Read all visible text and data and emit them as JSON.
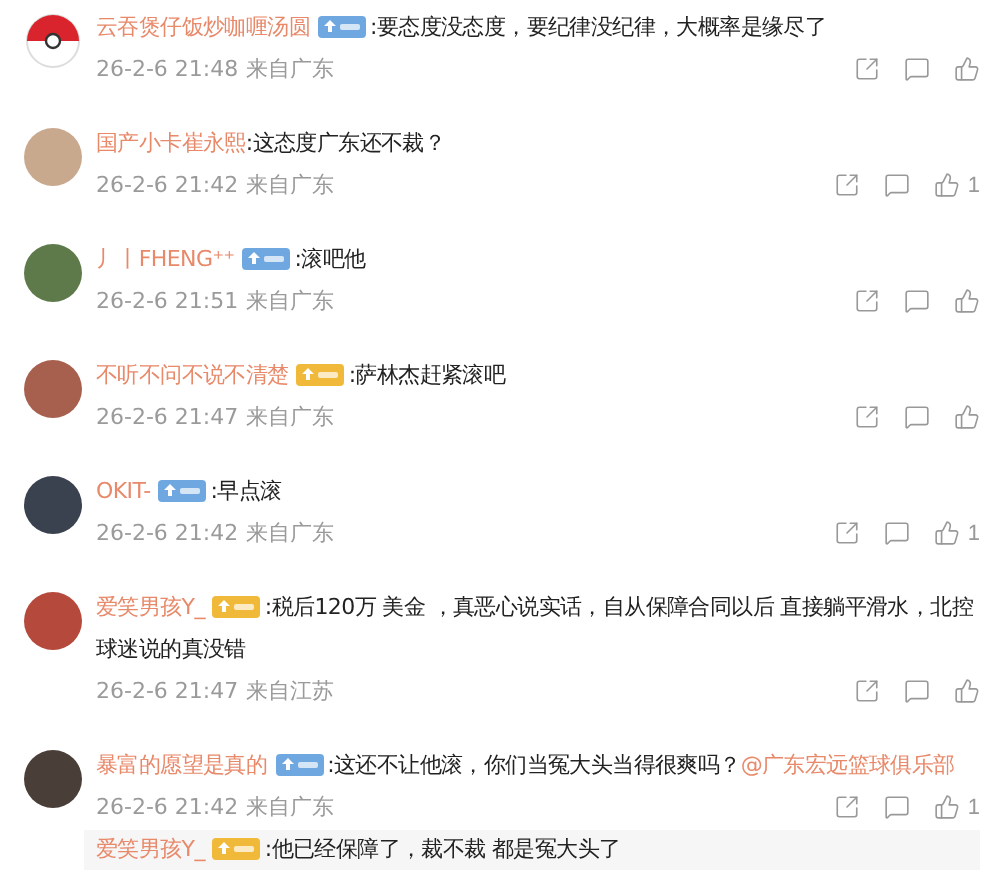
{
  "comments": [
    {
      "avatar": {
        "kind": "ball",
        "color": "#d9232d"
      },
      "name": "云吞煲仔饭炒咖喱汤圆",
      "badge": {
        "color": "#6fa8e0"
      },
      "text": ":要态度没态度，要纪律没纪律，大概率是缘尽了",
      "time": "26-2-6 21:48",
      "location": "来自广东"
    },
    {
      "avatar": {
        "kind": "plain",
        "color": "#c9a98e"
      },
      "name": "国产小卡崔永熙",
      "text": ":这态度广东还不裁？",
      "time": "26-2-6 21:42",
      "location": "来自广东",
      "likes": "1"
    },
    {
      "avatar": {
        "kind": "plain",
        "color": "#5f7a4a"
      },
      "name": "丿丨FHENG⁺⁺",
      "badge": {
        "color": "#6fa8e0"
      },
      "text": ":滚吧他",
      "time": "26-2-6 21:51",
      "location": "来自广东"
    },
    {
      "avatar": {
        "kind": "plain",
        "color": "#a8604e"
      },
      "name": "不听不问不说不清楚",
      "badge": {
        "color": "#f0b93a"
      },
      "text": ":萨林杰赶紧滚吧",
      "time": "26-2-6 21:47",
      "location": "来自广东"
    },
    {
      "avatar": {
        "kind": "plain",
        "color": "#3a4250"
      },
      "name": "OKIT-",
      "badge": {
        "color": "#6fa8e0"
      },
      "text": ":早点滚",
      "time": "26-2-6 21:42",
      "location": "来自广东",
      "likes": "1"
    },
    {
      "avatar": {
        "kind": "plain",
        "color": "#b5493c"
      },
      "name": "爱笑男孩Y_",
      "badge": {
        "color": "#f0b93a"
      },
      "text": ":税后120万 美金 ，真恶心说实话，自从保障合同以后 直接躺平滑水，北控球迷说的真没错",
      "time": "26-2-6 21:47",
      "location": "来自江苏"
    },
    {
      "avatar": {
        "kind": "plain",
        "color": "#4a3f38"
      },
      "name": "暴富的愿望是真的",
      "badge": {
        "color": "#6fa8e0"
      },
      "text": ":这还不让他滚，你们当冤大头当得很爽吗？",
      "mention": "@广东宏远篮球俱乐部",
      "time": "26-2-6 21:42",
      "location": "来自广东",
      "likes": "1",
      "reply": {
        "name": "爱笑男孩Y_",
        "badge": {
          "color": "#f0b93a"
        },
        "text": ":他已经保障了，裁不裁 都是冤大头了"
      }
    }
  ]
}
